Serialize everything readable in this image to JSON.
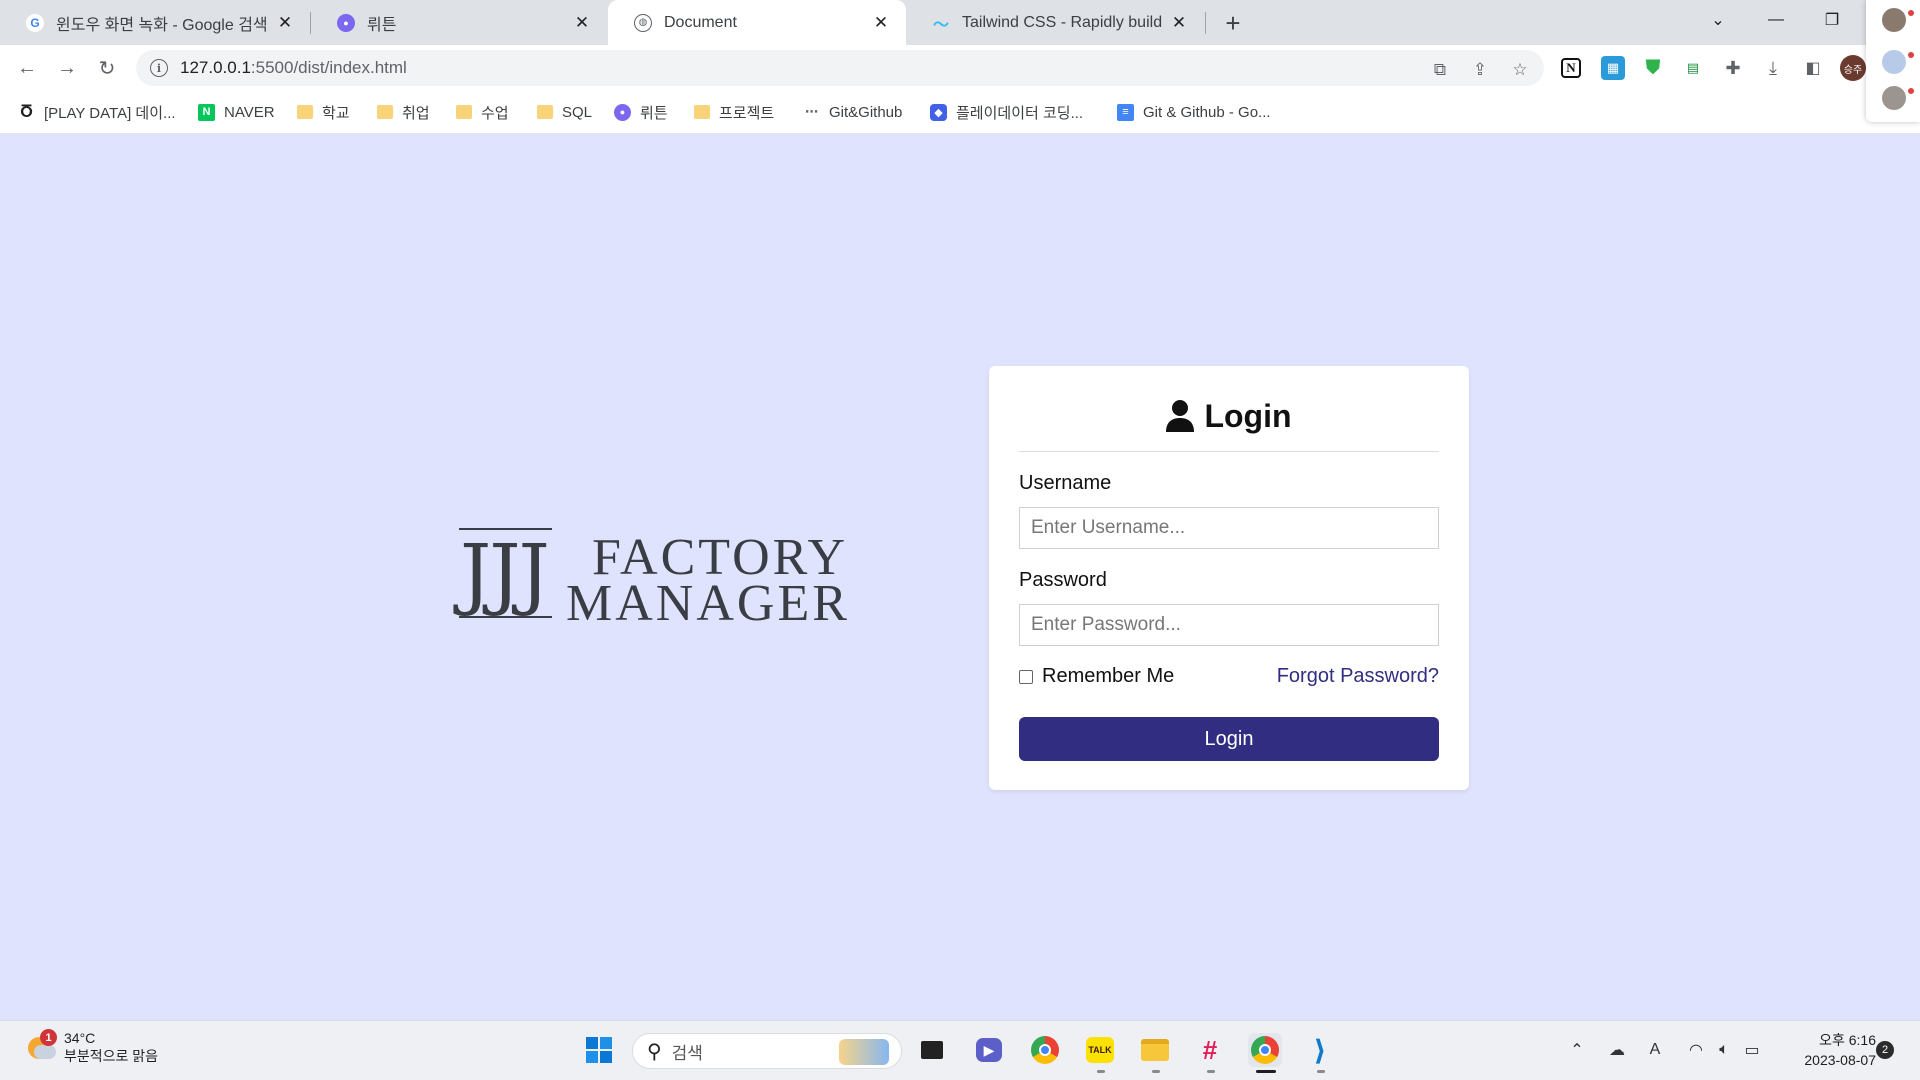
{
  "browser": {
    "tabs": [
      {
        "title": "윈도우 화면 녹화 - Google 검색",
        "favicon": "google-icon",
        "active": false
      },
      {
        "title": "뤼튼",
        "favicon": "wrtn-icon",
        "active": false
      },
      {
        "title": "Document",
        "favicon": "globe-icon",
        "active": true
      },
      {
        "title": "Tailwind CSS - Rapidly build mo",
        "favicon": "tailwind-icon",
        "active": false
      }
    ],
    "url_host": "127.0.0.1",
    "url_path": ":5500/dist/index.html",
    "bookmarks": [
      {
        "label": "[PLAY DATA] 데이...",
        "icon": "playdata-icon"
      },
      {
        "label": "NAVER",
        "icon": "naver-icon"
      },
      {
        "label": "학교",
        "icon": "folder-icon"
      },
      {
        "label": "취업",
        "icon": "folder-icon"
      },
      {
        "label": "수업",
        "icon": "folder-icon"
      },
      {
        "label": "SQL",
        "icon": "folder-icon"
      },
      {
        "label": "뤼튼",
        "icon": "wrtn-icon"
      },
      {
        "label": "프로젝트",
        "icon": "folder-icon"
      },
      {
        "label": "Git&Github",
        "icon": "git-icon"
      },
      {
        "label": "플레이데이터 코딩...",
        "icon": "playdata-coding-icon"
      },
      {
        "label": "Git & Github - Go...",
        "icon": "google-docs-icon"
      }
    ],
    "profile_badge": "승주"
  },
  "page": {
    "logo": {
      "mark": "JJJ",
      "line1": "FACTORY",
      "line2": "MANAGER"
    },
    "login": {
      "title": "Login",
      "username_label": "Username",
      "username_placeholder": "Enter Username...",
      "password_label": "Password",
      "password_placeholder": "Enter Password...",
      "remember_label": "Remember Me",
      "forgot_label": "Forgot Password?",
      "submit_label": "Login"
    },
    "colors": {
      "background": "#e0e3fd",
      "primary": "#312e81"
    }
  },
  "taskbar": {
    "weather_temp": "34°C",
    "weather_desc": "부분적으로 맑음",
    "weather_badge": "1",
    "search_placeholder": "검색",
    "time": "오후 6:16",
    "date": "2023-08-07",
    "notification_count": "2"
  }
}
